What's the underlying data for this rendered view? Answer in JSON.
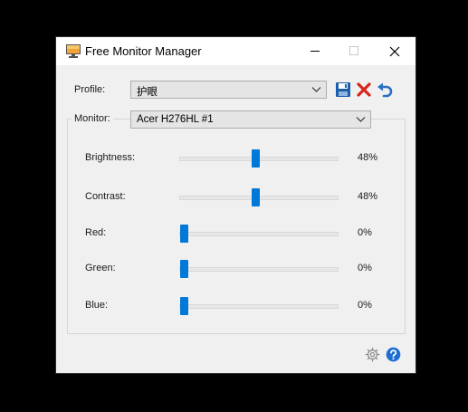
{
  "window": {
    "title": "Free Monitor Manager",
    "app_icon": "monitor-icon"
  },
  "titlebar_buttons": {
    "minimize_icon": "minimize-icon",
    "maximize_icon": "maximize-icon",
    "close_icon": "close-icon"
  },
  "profile": {
    "label": "Profile:",
    "selected": "护眼",
    "save_icon": "save-icon",
    "delete_icon": "delete-icon",
    "undo_icon": "undo-icon"
  },
  "monitor": {
    "label": "Monitor:",
    "selected": "Acer H276HL #1"
  },
  "sliders": [
    {
      "label": "Brightness:",
      "value": 48,
      "value_text": "48%"
    },
    {
      "label": "Contrast:",
      "value": 48,
      "value_text": "48%"
    },
    {
      "label": "Red:",
      "value": 0,
      "value_text": "0%"
    },
    {
      "label": "Green:",
      "value": 0,
      "value_text": "0%"
    },
    {
      "label": "Blue:",
      "value": 0,
      "value_text": "0%"
    }
  ],
  "footer": {
    "settings_icon": "gear-icon",
    "help_icon": "help-icon"
  },
  "colors": {
    "accent": "#0078d7",
    "delete_red": "#d9251d",
    "save_blue": "#1c5fa8"
  }
}
